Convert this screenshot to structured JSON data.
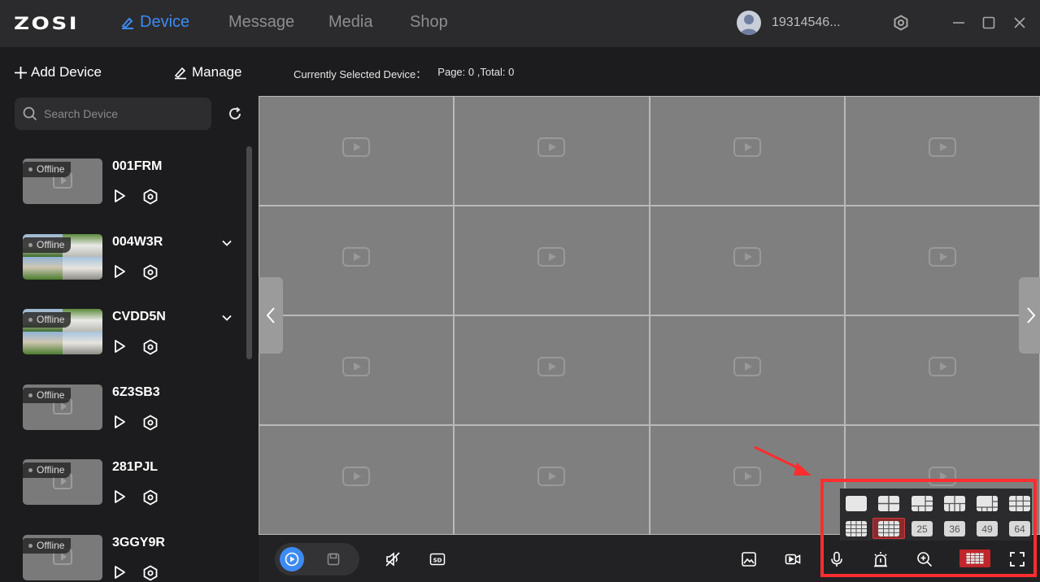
{
  "brand": "ZOSI",
  "nav": {
    "items": [
      {
        "label": "Device",
        "active": true
      },
      {
        "label": "Message",
        "active": false
      },
      {
        "label": "Media",
        "active": false
      },
      {
        "label": "Shop",
        "active": false
      }
    ]
  },
  "user": {
    "name": "19314546..."
  },
  "sidebar": {
    "add_device": "Add Device",
    "manage": "Manage",
    "search_placeholder": "Search Device",
    "devices": [
      {
        "name": "001FRM",
        "status": "Offline",
        "has_preview": false,
        "expandable": false
      },
      {
        "name": "004W3R",
        "status": "Offline",
        "has_preview": true,
        "expandable": true
      },
      {
        "name": "CVDD5N",
        "status": "Offline",
        "has_preview": true,
        "expandable": true
      },
      {
        "name": "6Z3SB3",
        "status": "Offline",
        "has_preview": false,
        "expandable": false
      },
      {
        "name": "281PJL",
        "status": "Offline",
        "has_preview": false,
        "expandable": false
      },
      {
        "name": "3GGY9R",
        "status": "Offline",
        "has_preview": false,
        "expandable": false
      }
    ]
  },
  "main": {
    "selected_label": "Currently Selected Device：",
    "page_label": "Page:",
    "page": "0",
    "total_label": ",Total:",
    "total": "0",
    "grid": {
      "rows": 4,
      "cols": 4
    }
  },
  "layouts": {
    "row1": [
      "1",
      "4",
      "6",
      "8",
      "9",
      "10"
    ],
    "row2": [
      "13",
      "16",
      "25",
      "36",
      "49",
      "64"
    ],
    "selected": "16"
  },
  "colors": {
    "accent": "#3d8bf2",
    "highlight": "#ff2d2d",
    "selected_layout": "#c0262b"
  }
}
